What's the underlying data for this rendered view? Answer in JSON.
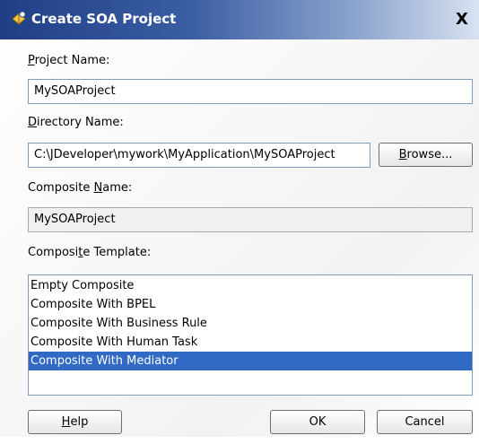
{
  "window": {
    "title": "Create SOA Project",
    "close_glyph": "X"
  },
  "form": {
    "project_name_label_pre": "",
    "project_name_label_ul": "P",
    "project_name_label_post": "roject Name:",
    "project_name_value": "MySOAProject",
    "directory_label_pre": "",
    "directory_label_ul": "D",
    "directory_label_post": "irectory Name:",
    "directory_value": "C:\\JDeveloper\\mywork\\MyApplication\\MySOAProject",
    "browse_label_pre": "",
    "browse_label_ul": "B",
    "browse_label_post": "rowse...",
    "composite_name_label_pre": "Composite ",
    "composite_name_label_ul": "N",
    "composite_name_label_post": "ame:",
    "composite_name_value": "MySOAProject",
    "template_label_pre": "Composi",
    "template_label_ul": "t",
    "template_label_post": "e Template:",
    "templates": [
      "Empty Composite",
      "Composite With BPEL",
      "Composite With Business Rule",
      "Composite With Human Task",
      "Composite With Mediator"
    ],
    "selected_template": "Composite With Mediator"
  },
  "buttons": {
    "help_pre": "",
    "help_ul": "H",
    "help_post": "elp",
    "ok": "OK",
    "cancel": "Cancel"
  },
  "colors": {
    "title_gradient_start": "#1f3e86",
    "selection": "#316ac5"
  }
}
